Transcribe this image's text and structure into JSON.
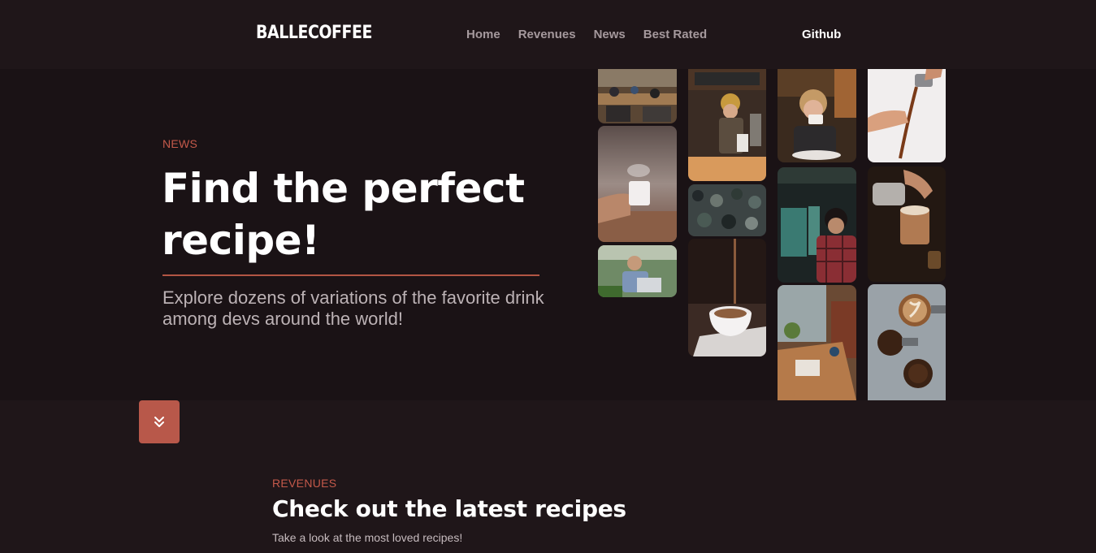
{
  "header": {
    "logo": "BALLECOFFEE",
    "nav": [
      "Home",
      "Revenues",
      "News",
      "Best Rated"
    ],
    "github_label": "Github"
  },
  "hero": {
    "eyebrow": "NEWS",
    "title": "Find the perfect recipe!",
    "subtitle": "Explore dozens of variations of the favorite drink among devs around the world!"
  },
  "gallery": {
    "photos": [
      "coworking-office-photo",
      "hand-holding-coffee-mug-photo",
      "man-with-laptop-photo",
      "barista-woman-photo",
      "busy-cafe-crowd-photo",
      "coffee-pour-cup-photo",
      "woman-drinking-coffee-photo",
      "developer-at-monitors-photo",
      "cafe-window-table-photo",
      "espresso-pour-hand-photo",
      "latte-art-pour-photo",
      "latte-and-beans-photo"
    ]
  },
  "scroll_button": {
    "icon": "chevrons-down-icon"
  },
  "recipes": {
    "eyebrow": "REVENUES",
    "title": "Check out the latest recipes",
    "subtitle": "Take a look at the most loved recipes!"
  },
  "colors": {
    "accent": "#c4594a",
    "button": "#b8584a",
    "background": "#1f1619",
    "hero_background": "#1a1215"
  }
}
